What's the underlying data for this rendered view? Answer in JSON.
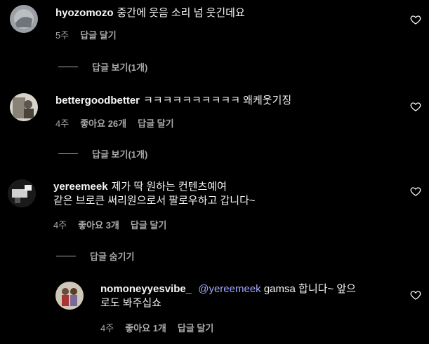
{
  "comments": [
    {
      "username": "hyozomozo",
      "text": "중간에 웃음 소리 넘 웃긴데요",
      "time": "5주",
      "reply_label": "답글 달기",
      "toggle_label": "답글 보기(1개)"
    },
    {
      "username": "bettergoodbetter",
      "text": "ㅋㅋㅋㅋㅋㅋㅋㅋㅋㅋ 왜케웃기징",
      "time": "4주",
      "likes": "좋아요 26개",
      "reply_label": "답글 달기",
      "toggle_label": "답글 보기(1개)"
    },
    {
      "username": "yereemeek",
      "text_line1": "제가 딱 원하는 컨텐츠예여",
      "text_line2": "같은 브로큰 써리원으로서 팔로우하고 갑니다~",
      "time": "4주",
      "likes": "좋아요 3개",
      "reply_label": "답글 달기",
      "toggle_label": "답글 숨기기"
    },
    {
      "username": "nomoneyyesvibe_",
      "mention": "@yereemeek",
      "text_line1": "gamsa 합니다~ 앞으",
      "text_line2": "로도 봐주십쇼",
      "time": "4주",
      "likes": "좋아요 1개",
      "reply_label": "답글 달기"
    }
  ],
  "icons": {
    "heart": "heart-outline-icon"
  },
  "colors": {
    "background": "#000000",
    "text": "#f5f5f5",
    "secondary": "#a8a8a8",
    "mention": "#a0a8ff"
  }
}
